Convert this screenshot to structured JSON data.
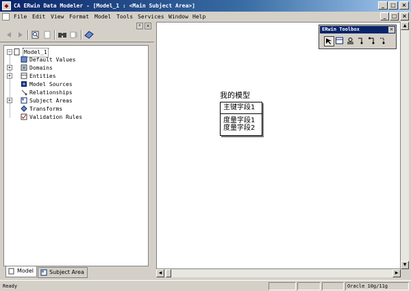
{
  "window": {
    "title": "CA ERwin Data Modeler - [Model_1 : <Main Subject Area>]",
    "controls": [
      "_",
      "□",
      "×"
    ],
    "doc_controls": [
      "_",
      "□",
      "×"
    ]
  },
  "menu": [
    "File",
    "Edit",
    "View",
    "Format",
    "Model",
    "Tools",
    "Services",
    "Window",
    "Help"
  ],
  "panel_controls": [
    "ᵖ",
    "×"
  ],
  "tree": {
    "root": "Model_1",
    "items": [
      {
        "label": "Default Values",
        "expandable": false
      },
      {
        "label": "Domains",
        "expandable": true
      },
      {
        "label": "Entities",
        "expandable": true
      },
      {
        "label": "Model Sources",
        "expandable": false
      },
      {
        "label": "Relationships",
        "expandable": false
      },
      {
        "label": "Subject Areas",
        "expandable": true
      },
      {
        "label": "Transforms",
        "expandable": false
      },
      {
        "label": "Validation Rules",
        "expandable": false
      }
    ]
  },
  "tabs": [
    {
      "label": "Model"
    },
    {
      "label": "Subject Area"
    }
  ],
  "entity": {
    "name": "我的模型",
    "key": "主键字段1",
    "attributes": [
      "度量字段1",
      "度量字段2"
    ]
  },
  "toolbox": {
    "title": "ERwin Toolbox",
    "close": "×"
  },
  "status": {
    "text": "Ready",
    "database": "Oracle 10g/11g"
  },
  "colors": {
    "title_bar": "#0a246a",
    "face": "#d4d0c8"
  }
}
